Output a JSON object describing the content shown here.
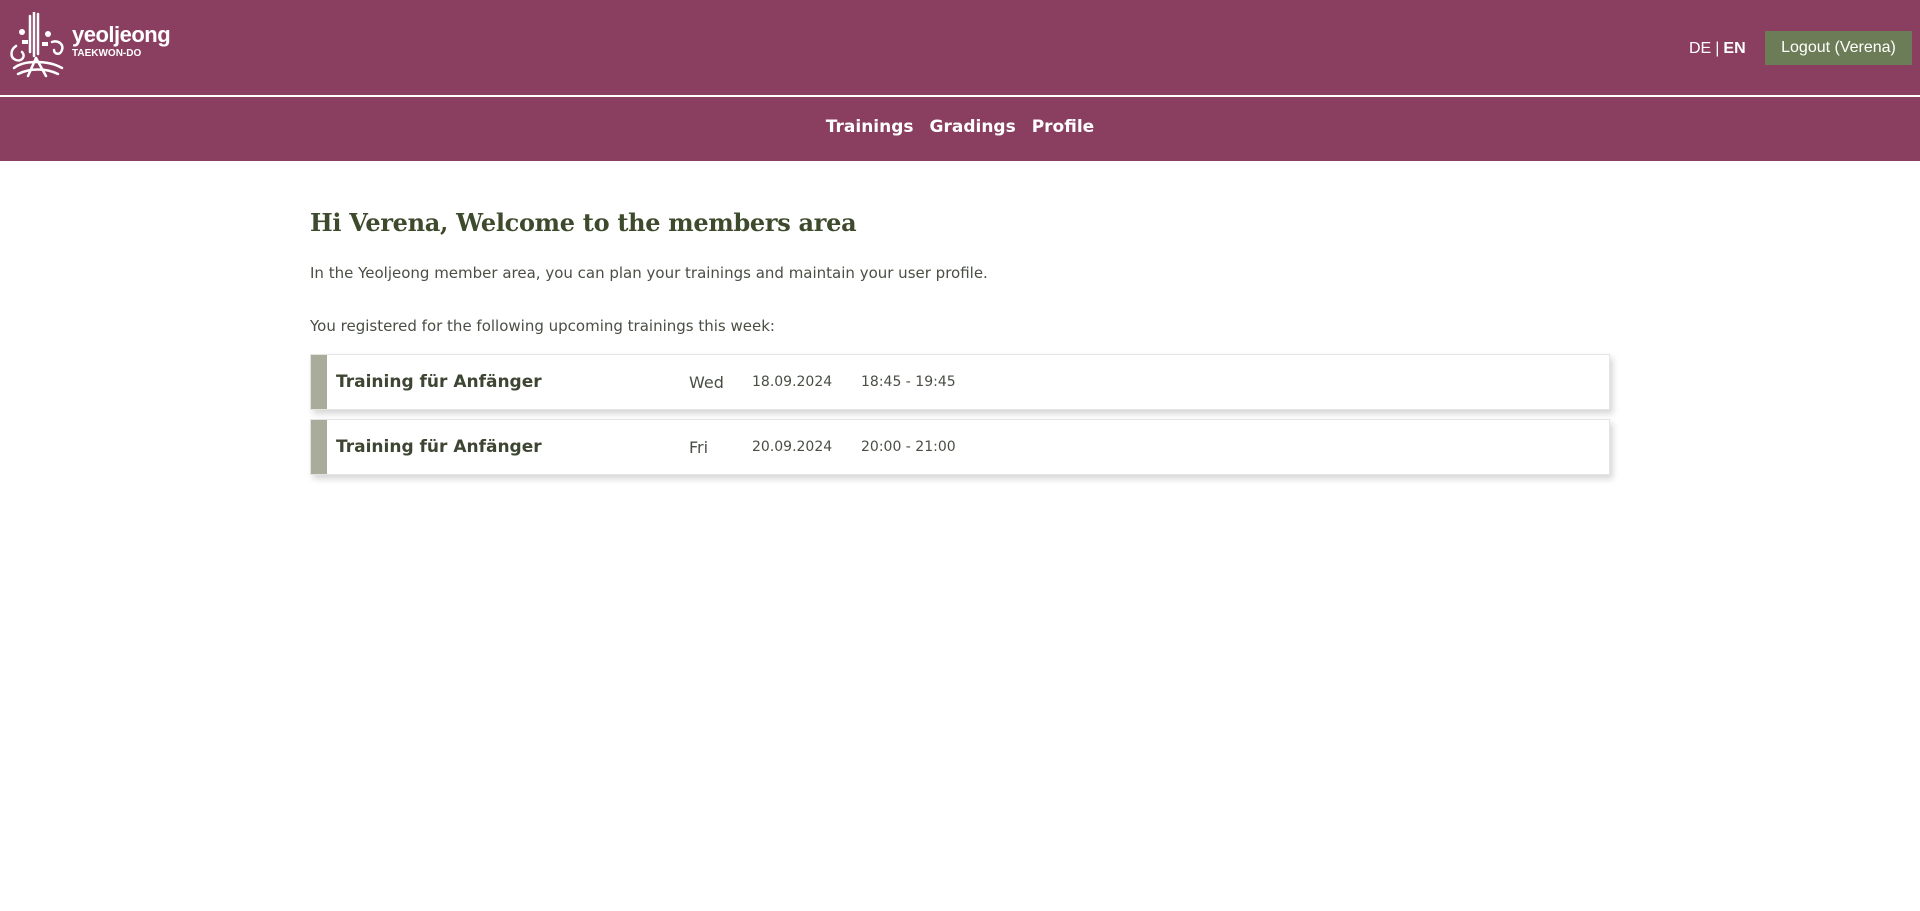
{
  "header": {
    "logo": {
      "name": "yeoljeong",
      "subtitle": "TAEKWON-DO"
    },
    "languages": [
      {
        "label": "DE",
        "active": false
      },
      {
        "label": "EN",
        "active": true
      }
    ],
    "language_separator": "|",
    "logout_label": "Logout (Verena)"
  },
  "nav": {
    "items": [
      {
        "label": "Trainings"
      },
      {
        "label": "Gradings"
      },
      {
        "label": "Profile"
      }
    ]
  },
  "main": {
    "title": "Hi Verena, Welcome to the members area",
    "intro": "In the Yeoljeong member area, you can plan your trainings and maintain your user profile.",
    "upcoming_label": "You registered for the following upcoming trainings this week:",
    "trainings": [
      {
        "title": "Training für Anfänger",
        "day": "Wed",
        "date": "18.09.2024",
        "time": "18:45 - 19:45"
      },
      {
        "title": "Training für Anfänger",
        "day": "Fri",
        "date": "20.09.2024",
        "time": "20:00 - 21:00"
      }
    ]
  },
  "colors": {
    "brand": "#8a3f60",
    "logout_button": "#6c7c56",
    "heading": "#3d4a2c",
    "card_accent": "#a9ac9a"
  }
}
